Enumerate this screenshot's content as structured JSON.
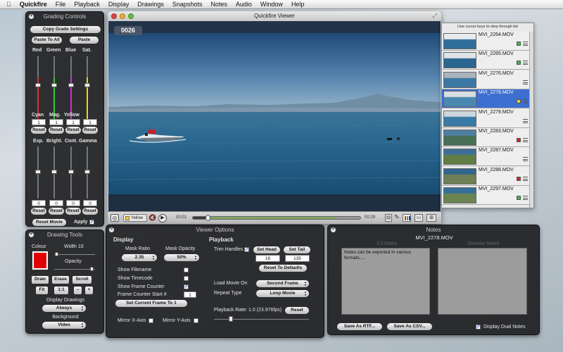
{
  "menubar": {
    "apple": "",
    "app": "Quickfire",
    "items": [
      "File",
      "Playback",
      "Display",
      "Drawings",
      "Snapshots",
      "Notes",
      "Audio",
      "Window",
      "Help"
    ]
  },
  "grading": {
    "title": "Grading Controls",
    "copy": "Copy Grade Settings",
    "paste_all": "Paste To All",
    "paste": "Paste",
    "top_labels": [
      "Red",
      "Green",
      "Blue",
      "Sat."
    ],
    "top_colors": [
      "#e23030",
      "#38c838",
      "#d02cd6",
      "#e8d820"
    ],
    "mid_labels": [
      "Cyan",
      "Mag.",
      "Yellow"
    ],
    "row1_values": [
      "1",
      "1",
      "1",
      "1"
    ],
    "reset": "Reset",
    "bottom_labels": [
      "Exp.",
      "Bright.",
      "Cont.",
      "Gamma"
    ],
    "row2_values": [
      "0",
      "0",
      "0",
      "0"
    ],
    "reset_movie": "Reset Movie",
    "apply": "Apply"
  },
  "drawing": {
    "title": "Drawing Tools",
    "colour_label": "Colour",
    "width_label": "Width 10",
    "opacity_label": "Opacity",
    "colour": "#e00000",
    "draw": "Draw",
    "erase": "Erase",
    "scroll": "Scroll",
    "fit": "Fit",
    "one_to_one": "1:1",
    "minus": "–",
    "plus": "+",
    "display_drawings_label": "Display Drawings",
    "display_drawings_value": "Always",
    "background_label": "Background",
    "background_value": "Video"
  },
  "viewer": {
    "title": "Quickfire Viewer",
    "frame": "0026",
    "flag_label": "Yellow",
    "time_start": "00:01",
    "time_end": "00:29",
    "progress": 0.09
  },
  "cliplist": {
    "hint": "Use cursor keys to step through list",
    "clips": [
      {
        "name": "MVI_2264.MOV",
        "flag": "#30c030",
        "selected": false
      },
      {
        "name": "MVI_2265.MOV",
        "flag": "#30c030",
        "selected": false
      },
      {
        "name": "MVI_2276.MOV",
        "flag": "",
        "selected": false
      },
      {
        "name": "MVI_2278.MOV",
        "flag": "#f0d020",
        "selected": true
      },
      {
        "name": "MVI_2279.MOV",
        "flag": "",
        "selected": false
      },
      {
        "name": "MVI_2283.MOV",
        "flag": "#e02020",
        "selected": false
      },
      {
        "name": "MVI_2287.MOV",
        "flag": "",
        "selected": false
      },
      {
        "name": "MVI_2288.MOV",
        "flag": "#e02020",
        "selected": false
      },
      {
        "name": "MVI_2297.MOV",
        "flag": "#30c030",
        "selected": false
      }
    ]
  },
  "options": {
    "title": "Viewer Options",
    "display": {
      "heading": "Display",
      "mask_ratio_label": "Mask Ratio",
      "mask_ratio_value": "2.35",
      "mask_opacity_label": "Mask Opacity",
      "mask_opacity_value": "50%",
      "show_filename": "Show Filename",
      "show_timecode": "Show Timecode",
      "show_frame_counter": "Show Frame Counter",
      "frame_counter_start": "Frame Counter Start #",
      "frame_counter_value": "1",
      "set_current": "Set Current Frame To 1",
      "mirror_x": "Mirror X-Axis",
      "mirror_y": "Mirror Y-Axis"
    },
    "playback": {
      "heading": "Playback",
      "trim_handles": "Trim Handles",
      "set_head": "Set Head",
      "set_tail": "Set Tail",
      "head_value": "16",
      "tail_value": "135",
      "reset_defaults": "Reset To Defaults",
      "load_movie_label": "Load Movie On",
      "load_movie_value": "Second Frame",
      "repeat_label": "Repeat Type",
      "repeat_value": "Loop Movie",
      "rate_label": "Playback Rate:  1.0  (23.976fps)",
      "reset": "Reset"
    }
  },
  "notes": {
    "title": "Notes",
    "file": "MVI_2278.MOV",
    "cj_label": "CJ Notes",
    "director_label": "Director Notes",
    "cj_text": "Notes can be exported in various formats.....",
    "save_rtf": "Save As RTF...",
    "save_csv": "Save As CSV...",
    "dual": "Display Dual Notes"
  }
}
